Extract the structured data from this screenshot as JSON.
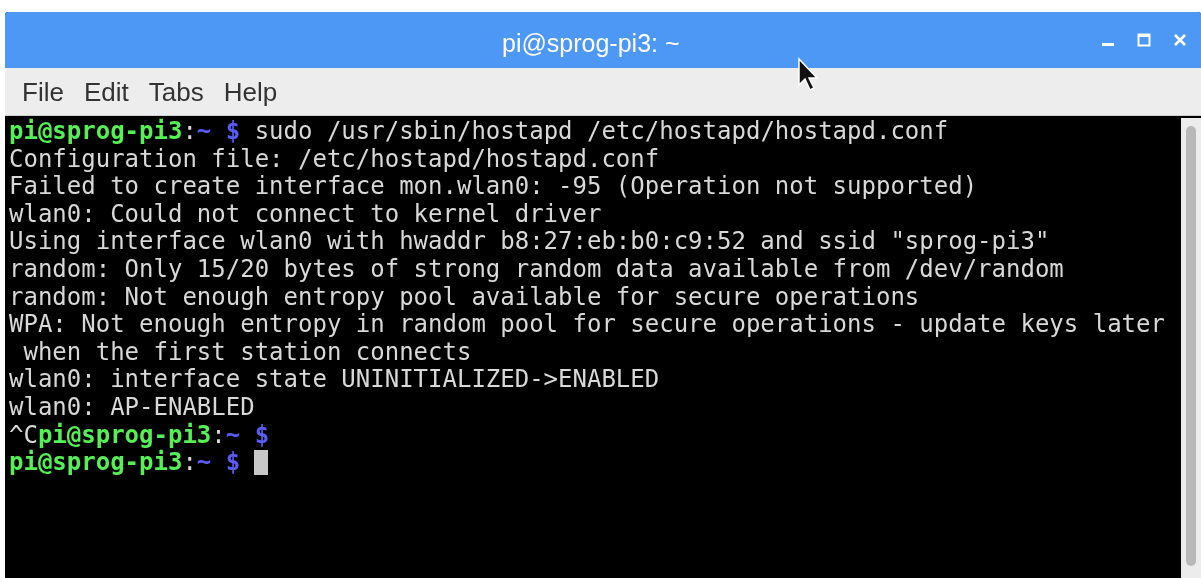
{
  "window": {
    "title": "pi@sprog-pi3: ~"
  },
  "menu": [
    {
      "label": "File"
    },
    {
      "label": "Edit"
    },
    {
      "label": "Tabs"
    },
    {
      "label": "Help"
    }
  ],
  "terminal": {
    "lines": [
      [
        {
          "kind": "user",
          "text": "pi@sprog-pi3"
        },
        {
          "kind": "text",
          "text": ":"
        },
        {
          "kind": "path",
          "text": "~ $"
        },
        {
          "kind": "text",
          "text": " sudo /usr/sbin/hostapd /etc/hostapd/hostapd.conf"
        }
      ],
      [
        {
          "kind": "text",
          "text": "Configuration file: /etc/hostapd/hostapd.conf"
        }
      ],
      [
        {
          "kind": "text",
          "text": "Failed to create interface mon.wlan0: -95 (Operation not supported)"
        }
      ],
      [
        {
          "kind": "text",
          "text": "wlan0: Could not connect to kernel driver"
        }
      ],
      [
        {
          "kind": "text",
          "text": "Using interface wlan0 with hwaddr b8:27:eb:b0:c9:52 and ssid \"sprog-pi3\""
        }
      ],
      [
        {
          "kind": "text",
          "text": "random: Only 15/20 bytes of strong random data available from /dev/random"
        }
      ],
      [
        {
          "kind": "text",
          "text": "random: Not enough entropy pool available for secure operations"
        }
      ],
      [
        {
          "kind": "text",
          "text": "WPA: Not enough entropy in random pool for secure operations - update keys later"
        }
      ],
      [
        {
          "kind": "text",
          "text": " when the first station connects"
        }
      ],
      [
        {
          "kind": "text",
          "text": "wlan0: interface state UNINITIALIZED->ENABLED"
        }
      ],
      [
        {
          "kind": "text",
          "text": "wlan0: AP-ENABLED"
        }
      ],
      [
        {
          "kind": "text",
          "text": "^C"
        },
        {
          "kind": "user",
          "text": "pi@sprog-pi3"
        },
        {
          "kind": "text",
          "text": ":"
        },
        {
          "kind": "path",
          "text": "~ $"
        }
      ],
      [
        {
          "kind": "user",
          "text": "pi@sprog-pi3"
        },
        {
          "kind": "text",
          "text": ":"
        },
        {
          "kind": "path",
          "text": "~ $"
        },
        {
          "kind": "cursor"
        }
      ]
    ]
  }
}
